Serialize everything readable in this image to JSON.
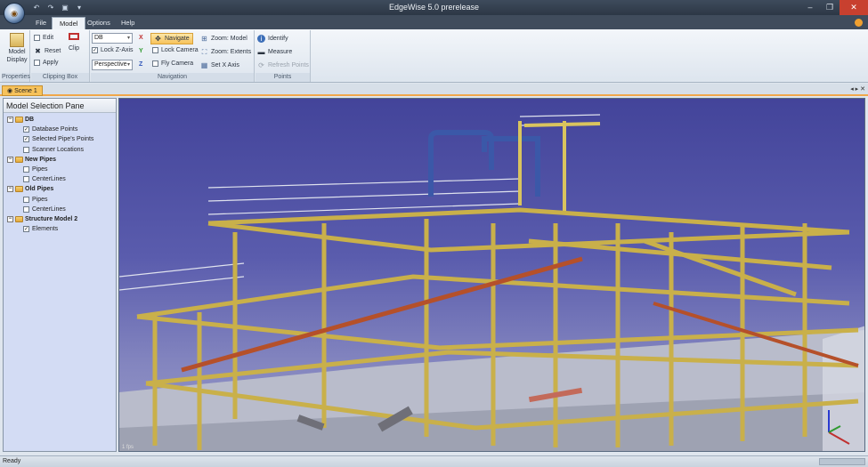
{
  "window": {
    "title": "EdgeWise 5.0 prerelease",
    "minimize": "–",
    "maximize": "❐",
    "close": "✕"
  },
  "ribbon_tabs": [
    "File",
    "Model",
    "Options",
    "Help"
  ],
  "groups": {
    "properties": {
      "label": "Properties",
      "model_display": "Model Display"
    },
    "clipping": {
      "label": "Clipping Box",
      "edit": "Edit",
      "reset": "Reset",
      "apply": "Apply",
      "clip": "Clip"
    },
    "navigation": {
      "label": "Navigation",
      "source_value": "DB",
      "x": "X",
      "y": "Y",
      "z": "Z",
      "lock_z": "Lock Z-Axis",
      "projection_value": "Perspective",
      "navigate": "Navigate",
      "lock_camera": "Lock Camera",
      "fly_camera": "Fly Camera",
      "zoom_model": "Zoom: Model",
      "zoom_extents": "Zoom: Extents",
      "set_x_axis": "Set X Axis"
    },
    "points": {
      "label": "Points",
      "identify": "Identify",
      "measure": "Measure",
      "refresh": "Refresh Points"
    }
  },
  "doc_tab": "Scene 1",
  "doc_controls": "◂ ▸ ✕",
  "pane": {
    "title": "Model Selection Pane",
    "tree": [
      {
        "label": "DB",
        "children": [
          {
            "label": "Database Points",
            "checked": true
          },
          {
            "label": "Selected Pipe's Points",
            "checked": true
          },
          {
            "label": "Scanner Locations",
            "checked": false
          }
        ]
      },
      {
        "label": "New Pipes",
        "children": [
          {
            "label": "Pipes",
            "checked": false
          },
          {
            "label": "CenterLines",
            "checked": false
          }
        ]
      },
      {
        "label": "Old Pipes",
        "children": [
          {
            "label": "Pipes",
            "checked": false
          },
          {
            "label": "CenterLines",
            "checked": false
          }
        ]
      },
      {
        "label": "Structure Model 2",
        "children": [
          {
            "label": "Elements",
            "checked": true
          }
        ]
      }
    ]
  },
  "viewport": {
    "fps": "1 fps"
  },
  "status": "Ready",
  "colors": {
    "sky": "#5a5cad",
    "steel": "#c9b04a",
    "pipe": "#b5502a",
    "accent": "#f0a74a"
  }
}
